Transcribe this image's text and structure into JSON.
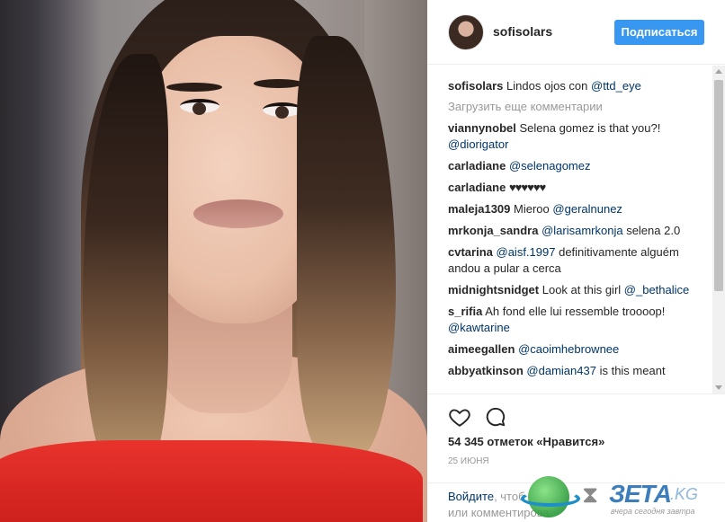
{
  "post": {
    "username": "sofisolars",
    "follow_label": "Подписаться"
  },
  "caption": {
    "user": "sofisolars",
    "text": "Lindos ojos con ",
    "mention": "@ttd_eye"
  },
  "load_more": "Загрузить еще комментарии",
  "comments": [
    {
      "user": "viannynobel",
      "text": "Selena gomez is that you?!",
      "mention": "@diorigator",
      "after": ""
    },
    {
      "user": "carladiane",
      "text": "",
      "mention": "@selenagomez",
      "after": ""
    },
    {
      "user": "carladiane",
      "text": "♥♥♥♥♥♥",
      "mention": "",
      "after": ""
    },
    {
      "user": "maleja1309",
      "text": "Mieroo",
      "mention": "@geralnunez",
      "after": ""
    },
    {
      "user": "mrkonja_sandra",
      "text": "",
      "mention": "@larisamrkonja",
      "after": "selena 2.0"
    },
    {
      "user": "cvtarina",
      "text": "",
      "mention": "@aisf.1997",
      "after": "definitivamente alguém andou a pular a cerca"
    },
    {
      "user": "midnightsnidget",
      "text": "Look at this girl",
      "mention": "@_bethalice",
      "after": ""
    },
    {
      "user": "s_rifia",
      "text": "Ah fond elle lui ressemble troooop!",
      "mention": "@kawtarine",
      "after": ""
    },
    {
      "user": "aimeegallen",
      "text": "",
      "mention": "@caoimhebrownee",
      "after": ""
    },
    {
      "user": "abbyatkinson",
      "text": "",
      "mention": "@damian437",
      "after": "is this meant"
    }
  ],
  "actions": {
    "like_icon": "heart-icon",
    "comment_icon": "speech-bubble-icon"
  },
  "likes": "54 345 отметок «Нравится»",
  "date": "25 июня",
  "login": {
    "link": "Войдите",
    "text_1": ", чтоб",
    "text_2": "или комментирова"
  },
  "watermark": {
    "name": "ЗЕТА",
    "tld": ".KG",
    "tagline": "вчера сегодня завтра"
  },
  "colors": {
    "accent": "#3897f0",
    "mention": "#003569",
    "muted": "#999999"
  }
}
